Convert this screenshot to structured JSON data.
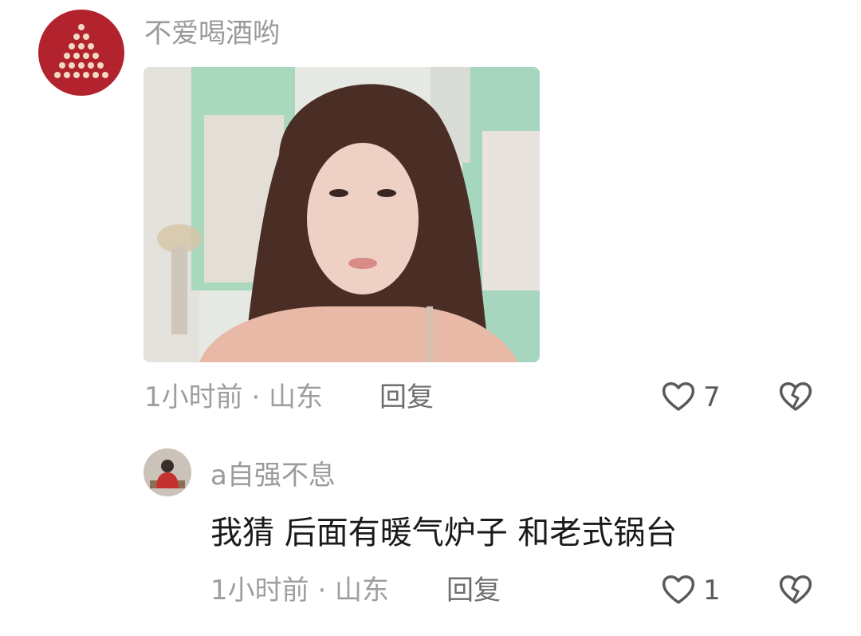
{
  "comment": {
    "username": "不爱喝酒哟",
    "time_location": "1小时前 · 山东",
    "reply_label": "回复",
    "like_count": "7",
    "icons": [
      "heart-outline-icon",
      "broken-heart-icon"
    ]
  },
  "reply_comment": {
    "username": "a自强不息",
    "text": "我猜  后面有暖气炉子  和老式锅台",
    "time_location": "1小时前 · 山东",
    "reply_label": "回复",
    "like_count": "1",
    "icons": [
      "heart-outline-icon",
      "broken-heart-icon"
    ]
  },
  "colors": {
    "avatar_red": "#b2232d",
    "muted_text": "#9e9e9e",
    "body_text": "#1a1a1a"
  }
}
